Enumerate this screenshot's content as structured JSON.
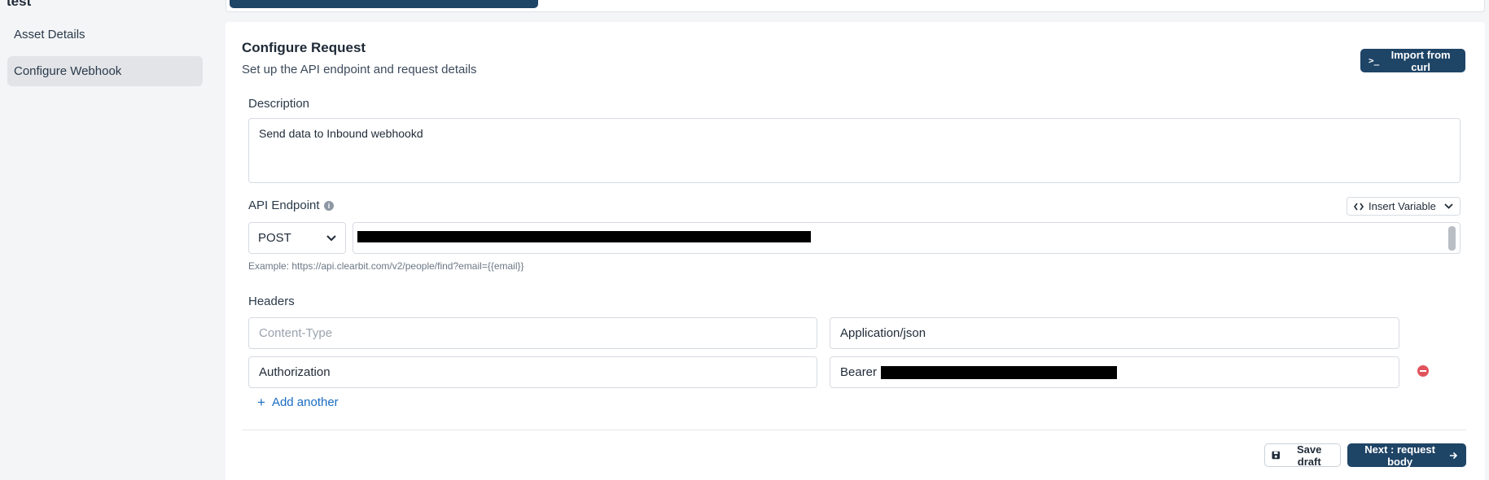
{
  "sidebar": {
    "title": "test",
    "items": [
      {
        "label": "Asset Details"
      },
      {
        "label": "Configure Webhook"
      }
    ]
  },
  "card": {
    "title": "Configure Request",
    "subtitle": "Set up the API endpoint and request details",
    "import_button": "Import from curl"
  },
  "description": {
    "label": "Description",
    "value": "Send data to Inbound webhookd"
  },
  "endpoint": {
    "label": "API Endpoint",
    "insert_variable": "Insert Variable",
    "method": "POST",
    "example": "Example: https://api.clearbit.com/v2/people/find?email={{email}}"
  },
  "headers": {
    "label": "Headers",
    "rows": [
      {
        "key": "",
        "key_placeholder": "Content-Type",
        "value": "Application/json"
      },
      {
        "key": "Authorization",
        "value": "Bearer"
      }
    ],
    "add_another": "Add another"
  },
  "footer": {
    "save_draft": "Save draft",
    "next": "Next : request body"
  },
  "colors": {
    "primary": "#1e4466",
    "link": "#1a6dc2",
    "danger": "#e0535c"
  }
}
